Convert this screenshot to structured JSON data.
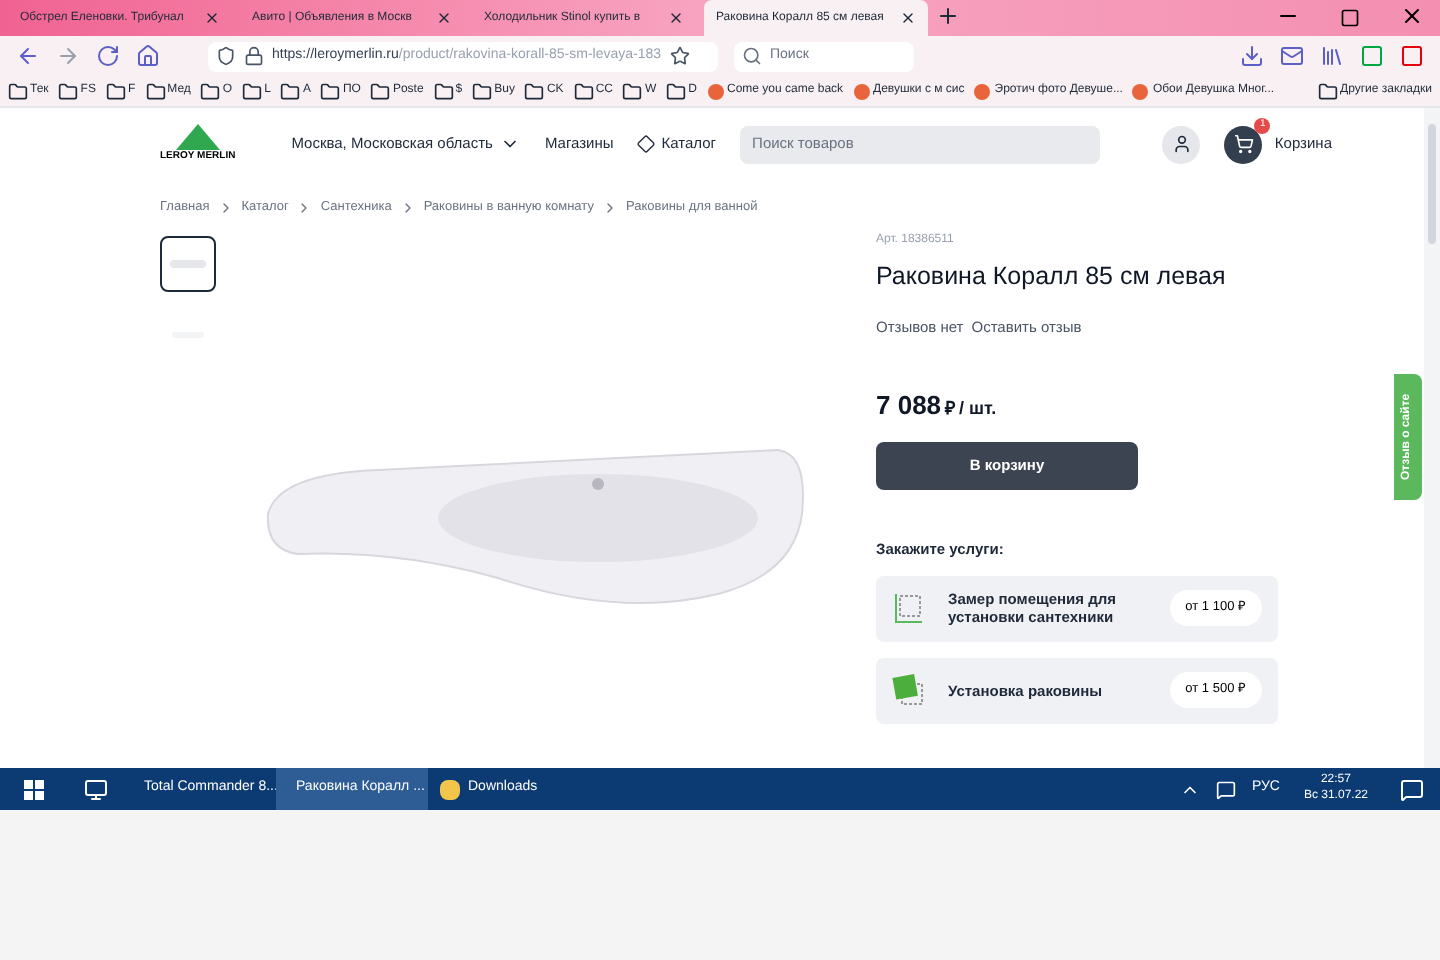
{
  "browser": {
    "tabs": [
      {
        "label": "Обстрел Еленовки. Трибунал",
        "selected": false
      },
      {
        "label": "Авито | Объявления в Москв",
        "selected": false
      },
      {
        "label": "Холодильник Stinol купить в",
        "selected": false
      },
      {
        "label": "Раковина Коралл 85 см левая",
        "selected": true
      }
    ],
    "url_host": "https://leroymerlin.ru",
    "url_path": "/product/rakovina-korall-85-sm-levaya-183",
    "search_placeholder": "Поиск",
    "bookmarks": [
      "Тек",
      "FS",
      "F",
      "Мед",
      "O",
      "L",
      "A",
      "ПО",
      "Poste",
      "$",
      "Buy",
      "CK",
      "CC",
      "W",
      "D"
    ],
    "bookmarks_named": [
      "Come you came back",
      "Девушки с м сис",
      "Эротич фото Девуше...",
      "Обои Девушка Мног..."
    ],
    "other_bookmarks": "Другие закладки"
  },
  "header": {
    "logo": "LEROY MERLIN",
    "region": "Москва, Московская область",
    "stores": "Магазины",
    "catalog": "Каталог",
    "search_placeholder": "Поиск товаров",
    "cart_count": "1",
    "cart": "Корзина"
  },
  "breadcrumbs": [
    "Главная",
    "Каталог",
    "Сантехника",
    "Раковины в ванную комнату",
    "Раковины для ванной"
  ],
  "product": {
    "article": "Арт. 18386511",
    "title": "Раковина Коралл 85 см левая",
    "reviews": "Отзывов нет",
    "leave_review": "Оставить отзыв",
    "price": "7 088",
    "currency": "₽",
    "unit": "/ шт.",
    "add_to_cart": "В корзину",
    "services_title": "Закажите услуги:",
    "services": [
      {
        "kind": "measure",
        "label": "Замер помещения для установки сантехники",
        "price": "от 1 100 ₽"
      },
      {
        "kind": "install",
        "label": "Установка раковины",
        "price": "от 1 500 ₽"
      }
    ]
  },
  "feedback_tab": "Отзыв о сайте",
  "taskbar": {
    "apps": [
      {
        "label": "Total Commander 8...",
        "selected": false
      },
      {
        "label": "Раковина Коралл ...",
        "selected": true
      },
      {
        "label": "Downloads",
        "selected": false
      }
    ],
    "lang": "РУС",
    "time": "22:57",
    "date": "Вс 31.07.22"
  }
}
